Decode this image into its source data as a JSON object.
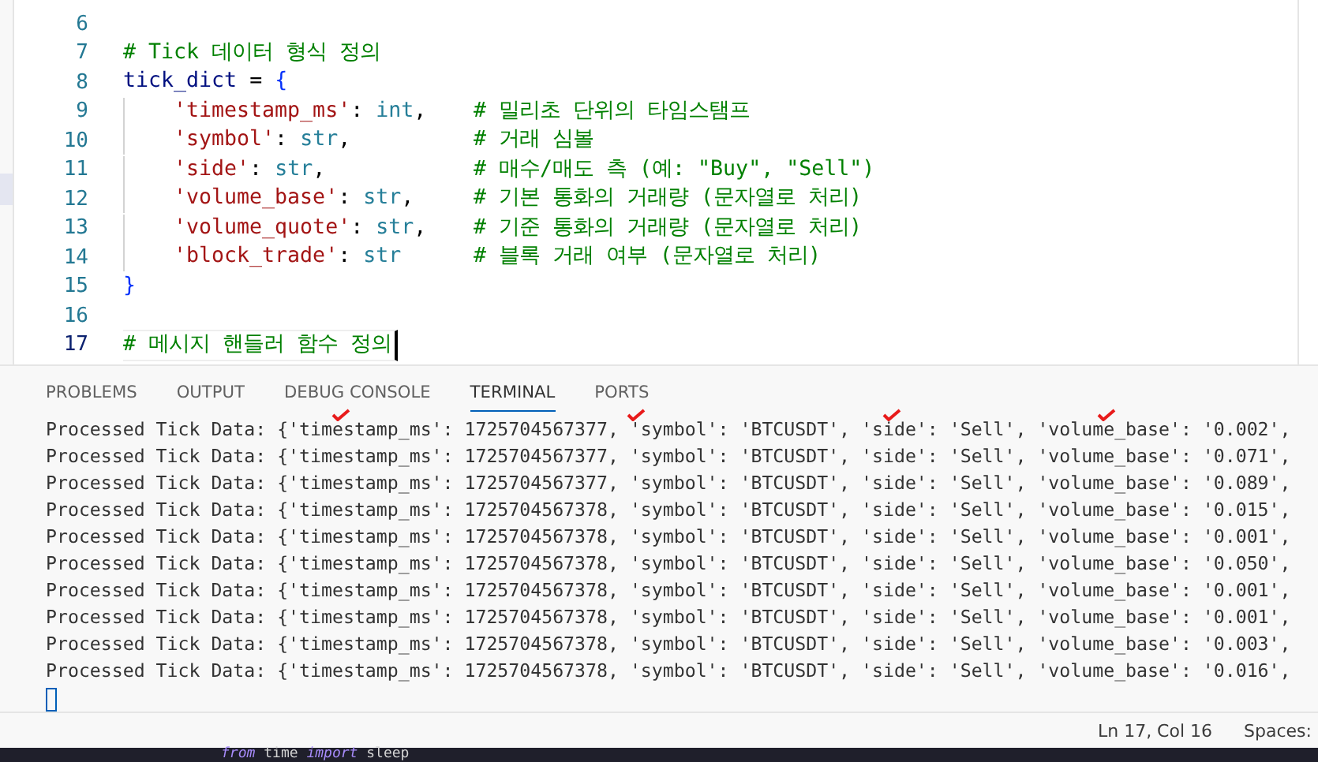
{
  "editor": {
    "lines": [
      {
        "number": "6",
        "active": false
      },
      {
        "number": "7",
        "active": false,
        "tokens": [
          {
            "text": "# Tick 데이터 형식 정의",
            "kind": "comment"
          }
        ]
      },
      {
        "number": "8",
        "active": false,
        "tokens": [
          {
            "text": "tick_dict",
            "kind": "variable"
          },
          {
            "text": " = ",
            "kind": "punct"
          },
          {
            "text": "{",
            "kind": "brace"
          }
        ]
      },
      {
        "number": "9",
        "active": false,
        "indented": true,
        "tokens": [
          {
            "text": "'timestamp_ms'",
            "kind": "string"
          },
          {
            "text": ": ",
            "kind": "punct"
          },
          {
            "text": "int",
            "kind": "type"
          },
          {
            "text": ",",
            "kind": "punct"
          }
        ],
        "comment": "# 밀리초 단위의 타임스탬프"
      },
      {
        "number": "10",
        "active": false,
        "indented": true,
        "tokens": [
          {
            "text": "'symbol'",
            "kind": "string"
          },
          {
            "text": ": ",
            "kind": "punct"
          },
          {
            "text": "str",
            "kind": "type"
          },
          {
            "text": ",",
            "kind": "punct"
          }
        ],
        "comment": "# 거래 심볼"
      },
      {
        "number": "11",
        "active": false,
        "indented": true,
        "tokens": [
          {
            "text": "'side'",
            "kind": "string"
          },
          {
            "text": ": ",
            "kind": "punct"
          },
          {
            "text": "str",
            "kind": "type"
          },
          {
            "text": ",",
            "kind": "punct"
          }
        ],
        "comment": "# 매수/매도 측 (예: \"Buy\", \"Sell\")"
      },
      {
        "number": "12",
        "active": false,
        "indented": true,
        "tokens": [
          {
            "text": "'volume_base'",
            "kind": "string"
          },
          {
            "text": ": ",
            "kind": "punct"
          },
          {
            "text": "str",
            "kind": "type"
          },
          {
            "text": ",",
            "kind": "punct"
          }
        ],
        "comment": "# 기본 통화의 거래량 (문자열로 처리)"
      },
      {
        "number": "13",
        "active": false,
        "indented": true,
        "tokens": [
          {
            "text": "'volume_quote'",
            "kind": "string"
          },
          {
            "text": ": ",
            "kind": "punct"
          },
          {
            "text": "str",
            "kind": "type"
          },
          {
            "text": ",",
            "kind": "punct"
          }
        ],
        "comment": "# 기준 통화의 거래량 (문자열로 처리)"
      },
      {
        "number": "14",
        "active": false,
        "indented": true,
        "tokens": [
          {
            "text": "'block_trade'",
            "kind": "string"
          },
          {
            "text": ": ",
            "kind": "punct"
          },
          {
            "text": "str",
            "kind": "type"
          }
        ],
        "comment": "# 블록 거래 여부 (문자열로 처리)"
      },
      {
        "number": "15",
        "active": false,
        "tokens": [
          {
            "text": "}",
            "kind": "brace"
          }
        ]
      },
      {
        "number": "16",
        "active": false
      },
      {
        "number": "17",
        "active": true,
        "tokens": [
          {
            "text": "# 메시지 핸들러 함수 정의",
            "kind": "comment"
          }
        ]
      }
    ]
  },
  "panel": {
    "tabs": [
      {
        "label": "PROBLEMS",
        "selected": false
      },
      {
        "label": "OUTPUT",
        "selected": false
      },
      {
        "label": "DEBUG CONSOLE",
        "selected": false
      },
      {
        "label": "TERMINAL",
        "selected": true
      },
      {
        "label": "PORTS",
        "selected": false
      }
    ],
    "terminal_lines": [
      "Processed Tick Data: {'timestamp_ms': 1725704567377, 'symbol': 'BTCUSDT', 'side': 'Sell', 'volume_base': '0.002',",
      "Processed Tick Data: {'timestamp_ms': 1725704567377, 'symbol': 'BTCUSDT', 'side': 'Sell', 'volume_base': '0.071',",
      "Processed Tick Data: {'timestamp_ms': 1725704567377, 'symbol': 'BTCUSDT', 'side': 'Sell', 'volume_base': '0.089',",
      "Processed Tick Data: {'timestamp_ms': 1725704567378, 'symbol': 'BTCUSDT', 'side': 'Sell', 'volume_base': '0.015',",
      "Processed Tick Data: {'timestamp_ms': 1725704567378, 'symbol': 'BTCUSDT', 'side': 'Sell', 'volume_base': '0.001',",
      "Processed Tick Data: {'timestamp_ms': 1725704567378, 'symbol': 'BTCUSDT', 'side': 'Sell', 'volume_base': '0.050',",
      "Processed Tick Data: {'timestamp_ms': 1725704567378, 'symbol': 'BTCUSDT', 'side': 'Sell', 'volume_base': '0.001',",
      "Processed Tick Data: {'timestamp_ms': 1725704567378, 'symbol': 'BTCUSDT', 'side': 'Sell', 'volume_base': '0.001',",
      "Processed Tick Data: {'timestamp_ms': 1725704567378, 'symbol': 'BTCUSDT', 'side': 'Sell', 'volume_base': '0.003',",
      "Processed Tick Data: {'timestamp_ms': 1725704567378, 'symbol': 'BTCUSDT', 'side': 'Sell', 'volume_base': '0.016',"
    ]
  },
  "status_bar": {
    "items": [
      "Ln 17, Col 16",
      "Spaces:"
    ]
  },
  "background_window": {
    "tokens": [
      {
        "text": "from",
        "kind": "keyword"
      },
      {
        "text": "time",
        "kind": "name"
      },
      {
        "text": "import",
        "kind": "keyword"
      },
      {
        "text": "sleep",
        "kind": "name"
      }
    ]
  }
}
